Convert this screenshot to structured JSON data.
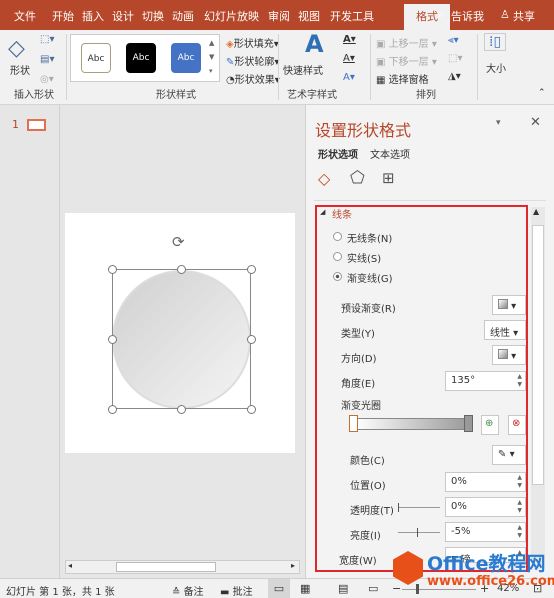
{
  "tabs": [
    "文件",
    "开始",
    "插入",
    "设计",
    "切换",
    "动画",
    "幻灯片放映",
    "审阅",
    "视图",
    "开发工具",
    "格式"
  ],
  "tell_me": "告诉我",
  "share": "共享",
  "ribbon": {
    "insert_shape": {
      "shapes": "形状",
      "group": "插入形状"
    },
    "shape_styles": {
      "samples": [
        "Abc",
        "Abc",
        "Abc"
      ],
      "fill": "形状填充",
      "outline": "形状轮廓",
      "effects": "形状效果",
      "group": "形状样式"
    },
    "wordart": {
      "quick": "快速样式",
      "group": "艺术字样式"
    },
    "arrange": {
      "forward": "上移一层",
      "backward": "下移一层",
      "pane": "选择窗格",
      "group": "排列"
    },
    "size": {
      "label": "大小"
    }
  },
  "thumb": {
    "number": "1"
  },
  "pane": {
    "title": "设置形状格式",
    "tabs": [
      "形状选项",
      "文本选项"
    ],
    "section": "线条",
    "radios": [
      {
        "label": "无线条(N)",
        "checked": false
      },
      {
        "label": "实线(S)",
        "checked": false
      },
      {
        "label": "渐变线(G)",
        "checked": true
      }
    ],
    "preset": "预设渐变(R)",
    "type_label": "类型(Y)",
    "type_value": "线性",
    "direction": "方向(D)",
    "angle_label": "角度(E)",
    "angle_value": "135°",
    "stops_label": "渐变光圈",
    "color": "颜色(C)",
    "position_label": "位置(O)",
    "position_value": "0%",
    "transparency_label": "透明度(T)",
    "transparency_value": "0%",
    "brightness_label": "亮度(I)",
    "brightness_value": "-5%",
    "width_label": "宽度(W)",
    "width_value": "5 磅"
  },
  "status": {
    "slide": "幻灯片 第 1 张，共 1 张",
    "notes": "备注",
    "comments": "批注",
    "zoom": "42%"
  },
  "watermark": {
    "brand": "Office教程网",
    "url": "www.office26.com"
  },
  "colors": {
    "accent": "#b7472a",
    "highlight": "#e0262f"
  }
}
